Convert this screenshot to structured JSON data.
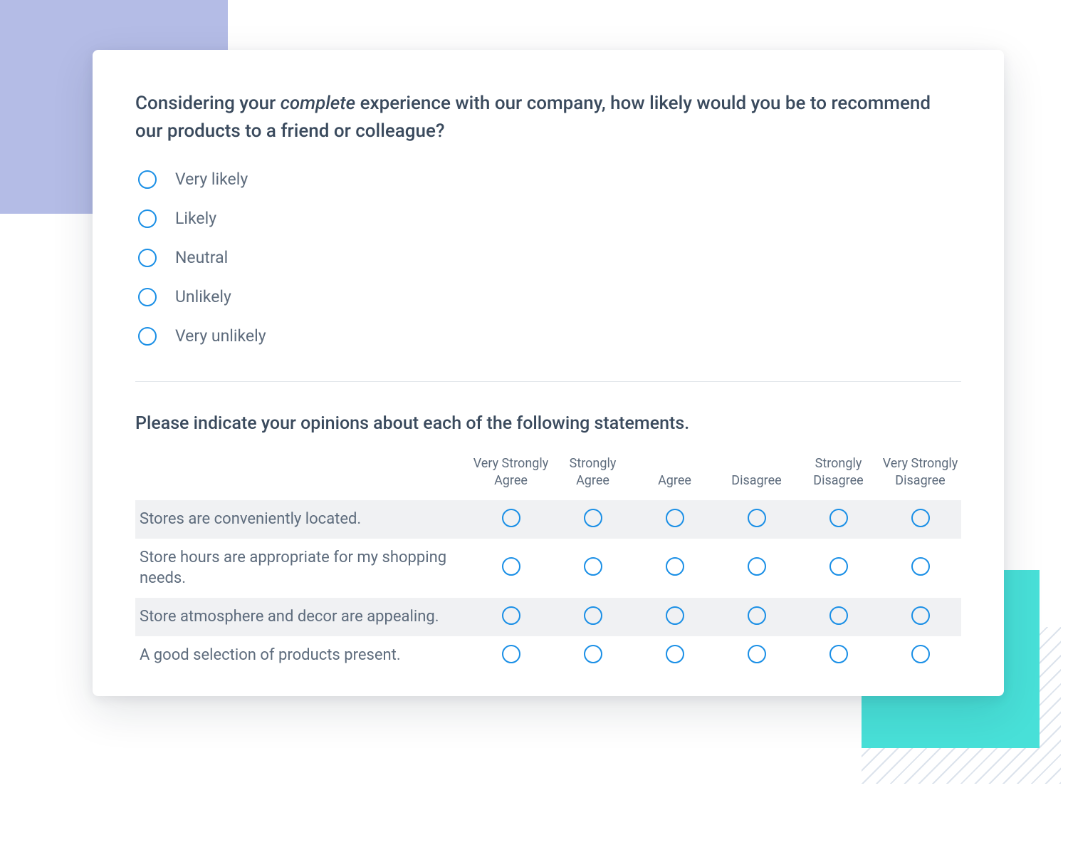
{
  "question1": {
    "prefix": "Considering your ",
    "emphasis": "complete",
    "suffix": " experience with our company, how likely would you be to recommend our products to a friend or colleague?",
    "options": [
      "Very likely",
      "Likely",
      "Neutral",
      "Unlikely",
      "Very unlikely"
    ]
  },
  "question2": {
    "prompt": "Please indicate your opinions about each of the following statements.",
    "columns": [
      "Very Strongly Agree",
      "Strongly Agree",
      "Agree",
      "Disagree",
      "Strongly Disagree",
      "Very Strongly Disagree"
    ],
    "rows": [
      "Stores are conveniently located.",
      "Store hours are appropriate for my shopping needs.",
      "Store atmosphere and decor are appealing.",
      "A good selection of products present."
    ]
  }
}
